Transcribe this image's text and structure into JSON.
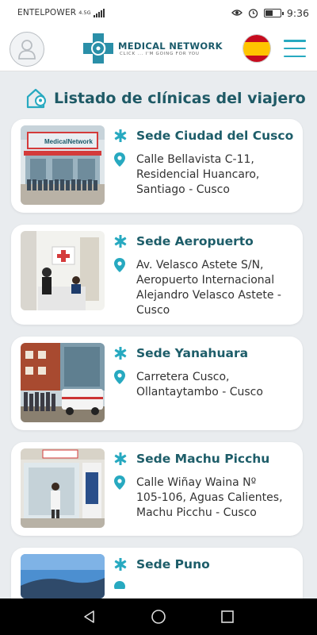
{
  "status_bar": {
    "carrier": "ENTELPOWER",
    "network_top": "4.5G",
    "network_bottom": "",
    "time": "9:36",
    "icons": [
      "eye-icon",
      "alarm-icon",
      "battery-icon"
    ]
  },
  "header": {
    "logo_title": "MEDICAL NETWORK",
    "logo_subtitle": "CLICK ... I'M GOING FOR YOU",
    "avatar_icon": "user-avatar-icon",
    "flag_icon": "spain-flag-icon",
    "menu_icon": "hamburger-menu-icon"
  },
  "page": {
    "title": "Listado de clínicas del viajero",
    "title_icon": "home-location-icon"
  },
  "colors": {
    "accent": "#27a9c0",
    "title": "#1f5a66",
    "card_bg": "#ffffff",
    "page_bg": "#e9ecef"
  },
  "clinics": [
    {
      "name": "Sede Ciudad del Cusco",
      "address_lines": [
        "Calle Bellavista C-11,",
        "Residencial Huancaro,",
        "Santiago - Cusco"
      ],
      "photo_sign": "MedicalNetwork"
    },
    {
      "name": "Sede Aeropuerto",
      "address_lines": [
        "Av. Velasco Astete S/N,",
        "Aeropuerto Internacional",
        "Alejandro Velasco Astete -",
        "Cusco"
      ]
    },
    {
      "name": "Sede Yanahuara",
      "address_lines": [
        "Carretera Cusco,",
        "Ollantaytambo - Cusco"
      ]
    },
    {
      "name": "Sede Machu Picchu",
      "address_lines": [
        "Calle Wiñay Waina Nº",
        "105-106, Aguas Calientes,",
        "Machu Picchu - Cusco"
      ]
    },
    {
      "name": "Sede Puno",
      "address_lines": []
    }
  ],
  "nav": {
    "back_icon": "back-triangle-icon",
    "home_icon": "home-circle-icon",
    "recents_icon": "recents-square-icon"
  }
}
